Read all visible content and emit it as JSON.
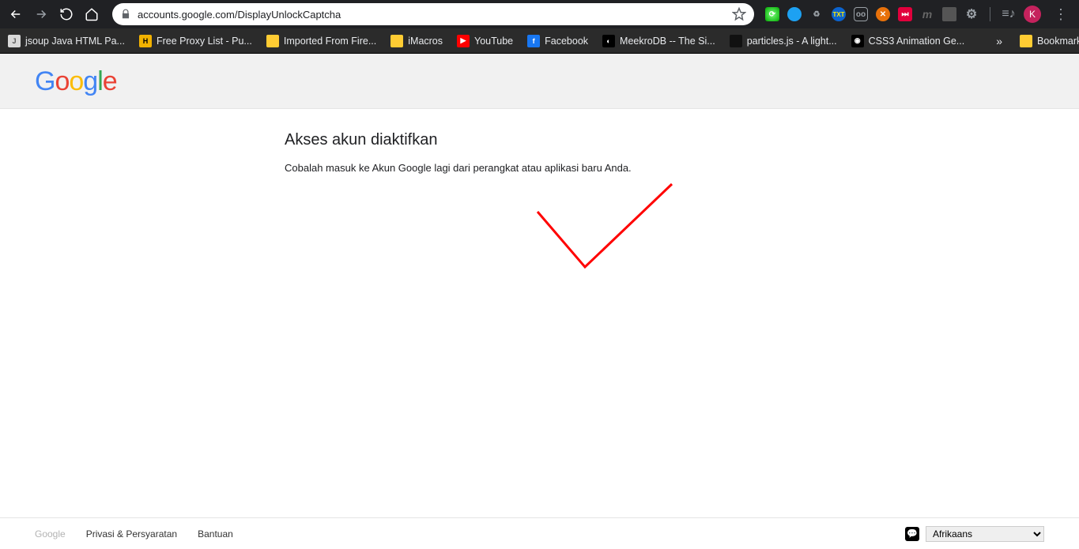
{
  "browser": {
    "url": "accounts.google.com/DisplayUnlockCaptcha",
    "profile_initial": "K"
  },
  "bookmarks": [
    {
      "label": "jsoup Java HTML Pa...",
      "bg": "#d9d9d9",
      "fg": "#555",
      "letter": "J"
    },
    {
      "label": "Free Proxy List - Pu...",
      "bg": "#f2b200",
      "fg": "#000",
      "letter": "H"
    },
    {
      "label": "Imported From Fire...",
      "bg": "#ffcc33",
      "fg": "#ffcc33",
      "letter": ""
    },
    {
      "label": "iMacros",
      "bg": "#ffcc33",
      "fg": "#ffcc33",
      "letter": ""
    },
    {
      "label": "YouTube",
      "bg": "#ff0000",
      "fg": "#fff",
      "letter": "▶"
    },
    {
      "label": "Facebook",
      "bg": "#1877f2",
      "fg": "#fff",
      "letter": "f"
    },
    {
      "label": "MeekroDB -- The Si...",
      "bg": "#000",
      "fg": "#fff",
      "letter": "◐"
    },
    {
      "label": "particles.js - A light...",
      "bg": "#111",
      "fg": "#111",
      "letter": ""
    },
    {
      "label": "CSS3 Animation Ge...",
      "bg": "#000",
      "fg": "#fff",
      "letter": "◉"
    }
  ],
  "bookmark_other": "Bookmark lain",
  "page": {
    "heading": "Akses akun diaktifkan",
    "body": "Cobalah masuk ke Akun Google lagi dari perangkat atau aplikasi baru Anda."
  },
  "footer": {
    "brand": "Google",
    "links": [
      "Privasi & Persyaratan",
      "Bantuan"
    ],
    "language": "Afrikaans"
  }
}
